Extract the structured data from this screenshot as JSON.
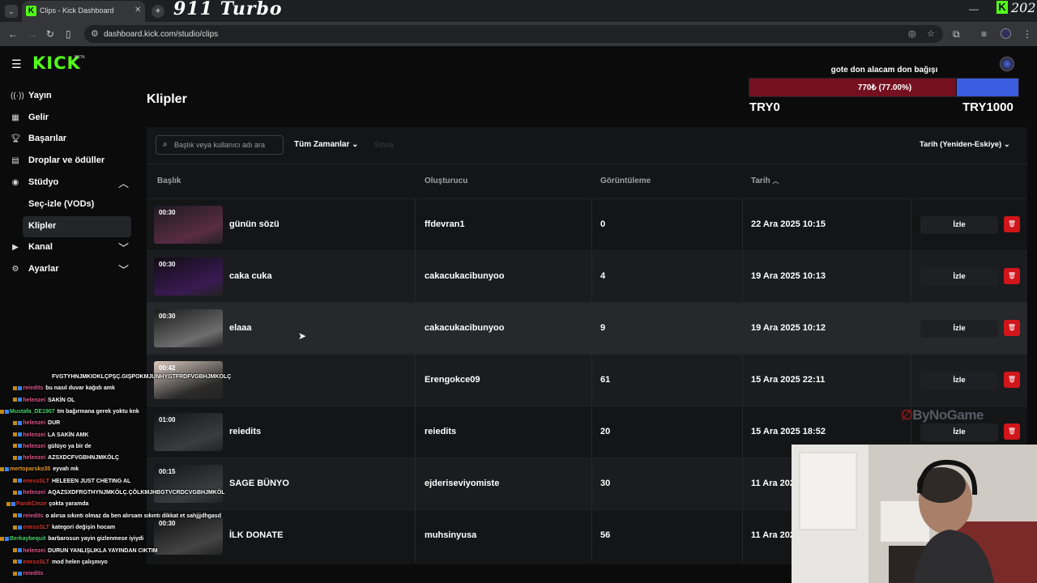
{
  "browser": {
    "tab_title": "Clips - Kick Dashboard",
    "overlay_logo": "911 Turbo",
    "brand_year": "202",
    "url": "dashboard.kick.com/studio/clips"
  },
  "app": {
    "logo": "KICK",
    "beta": "BETA"
  },
  "sidebar": {
    "items": [
      {
        "label": "Yayın",
        "icon": "broadcast-icon"
      },
      {
        "label": "Gelir",
        "icon": "revenue-icon"
      },
      {
        "label": "Başarılar",
        "icon": "trophy-icon"
      },
      {
        "label": "Droplar ve ödüller",
        "icon": "drops-icon"
      },
      {
        "label": "Stüdyo",
        "icon": "studio-icon"
      },
      {
        "label": "Seç-izle (VODs)"
      },
      {
        "label": "Klipler"
      },
      {
        "label": "Kanal",
        "icon": "channel-icon"
      },
      {
        "label": "Ayarlar",
        "icon": "gear-icon"
      }
    ]
  },
  "page": {
    "title": "Klipler"
  },
  "goal": {
    "title": "gote don alacam don bağışı",
    "progress_text": "770₺ (77.00%)",
    "progress_fraction": 0.77,
    "min": "TRY0",
    "max": "TRY1000",
    "fill_color": "#741020",
    "rest_color": "#3c5ddf"
  },
  "toolbar": {
    "search_placeholder": "Başlık veya kullanıcı adı ara",
    "time_filter": "Tüm Zamanlar",
    "clear": "Sıfırla",
    "sort": "Tarih (Yeniden-Eskiye)"
  },
  "table": {
    "headers": {
      "title": "Başlık",
      "creator": "Oluşturucu",
      "views": "Görüntüleme",
      "date": "Tarih"
    },
    "watch_label": "İzle",
    "rows": [
      {
        "duration": "00:30",
        "title": "günün sözü",
        "creator": "ffdevran1",
        "views": "0",
        "date": "22 Ara 2025 10:15"
      },
      {
        "duration": "00:30",
        "title": "caka cuka",
        "creator": "cakacukacibunyoo",
        "views": "4",
        "date": "19 Ara 2025 10:13"
      },
      {
        "duration": "00:30",
        "title": "elaaa",
        "creator": "cakacukacibunyoo",
        "views": "9",
        "date": "19 Ara 2025 10:12"
      },
      {
        "duration": "00:42",
        "title": "",
        "creator": "Erengokce09",
        "views": "61",
        "date": "15 Ara 2025 22:11"
      },
      {
        "duration": "01:00",
        "title": "reiedits",
        "creator": "reiedits",
        "views": "20",
        "date": "15 Ara 2025 18:52"
      },
      {
        "duration": "00:15",
        "title": "SAGE BÜNYO",
        "creator": "ejderiseviyomiste",
        "views": "30",
        "date": "11 Ara 202"
      },
      {
        "duration": "00:30",
        "title": "İLK DONATE",
        "creator": "muhsinyusa",
        "views": "56",
        "date": "11 Ara 202"
      }
    ]
  },
  "chat": [
    {
      "user": "",
      "text": "FVGTYHNJMKIOKLÇPŞÇ.GIŞPOKMJUNHYGTFRDFVGBHJMKOLÇ",
      "color": "#ffffff"
    },
    {
      "user": "reiedits",
      "text": "bu nasıl duvar kağıdı amk",
      "color": "#e0568a"
    },
    {
      "user": "helenzei",
      "text": "SAKİN OL",
      "color": "#e0568a"
    },
    {
      "user": "Mustafa_DE1907",
      "text": "tm bağırmana gerek yoktu knk",
      "color": "#46d46b"
    },
    {
      "user": "helenzei",
      "text": "DUR",
      "color": "#e0568a"
    },
    {
      "user": "helenzei",
      "text": "LA SAKİN AMK",
      "color": "#e0568a"
    },
    {
      "user": "helenzei",
      "text": "gülüyo ya bir de",
      "color": "#e0568a"
    },
    {
      "user": "helenzei",
      "text": "AZSXDCFVGBHNJMKÖLÇ",
      "color": "#e0568a"
    },
    {
      "user": "mertoparsko35",
      "text": "eyvah mk",
      "color": "#e89a2a"
    },
    {
      "user": "enessSLT",
      "text": "HELEEEN JUST CHETING AL",
      "color": "#d9342b"
    },
    {
      "user": "helenzei",
      "text": "AQAZSXDFRGTHYNJMKÖLÇ.ÇÖLKMJHBGTVCRDCVGBHJMKÖL",
      "color": "#e0568a"
    },
    {
      "user": "PanikCinze",
      "text": "çokta yaramda",
      "color": "#d9342b"
    },
    {
      "user": "reiedits",
      "text": "o alırsa sıkıntı olmaz da ben alırsam sıkıntı dikkat et sahjjjdhgasd",
      "color": "#e0568a"
    },
    {
      "user": "enessSLT",
      "text": "kategori değişin hocam",
      "color": "#d9342b"
    },
    {
      "user": "Berkaybequit",
      "text": "barbarosun yayin gizlenmese iyiydi",
      "color": "#46d46b"
    },
    {
      "user": "helenzei",
      "text": "DURUN YANLIŞLIKLA YAYINDAN CIKTIM",
      "color": "#e0568a"
    },
    {
      "user": "enessSLT",
      "text": "mod helen çalışmıyo",
      "color": "#d9342b"
    },
    {
      "user": "reiedits",
      "text": "",
      "color": "#e0568a"
    }
  ],
  "watermark": "ByNoGame"
}
